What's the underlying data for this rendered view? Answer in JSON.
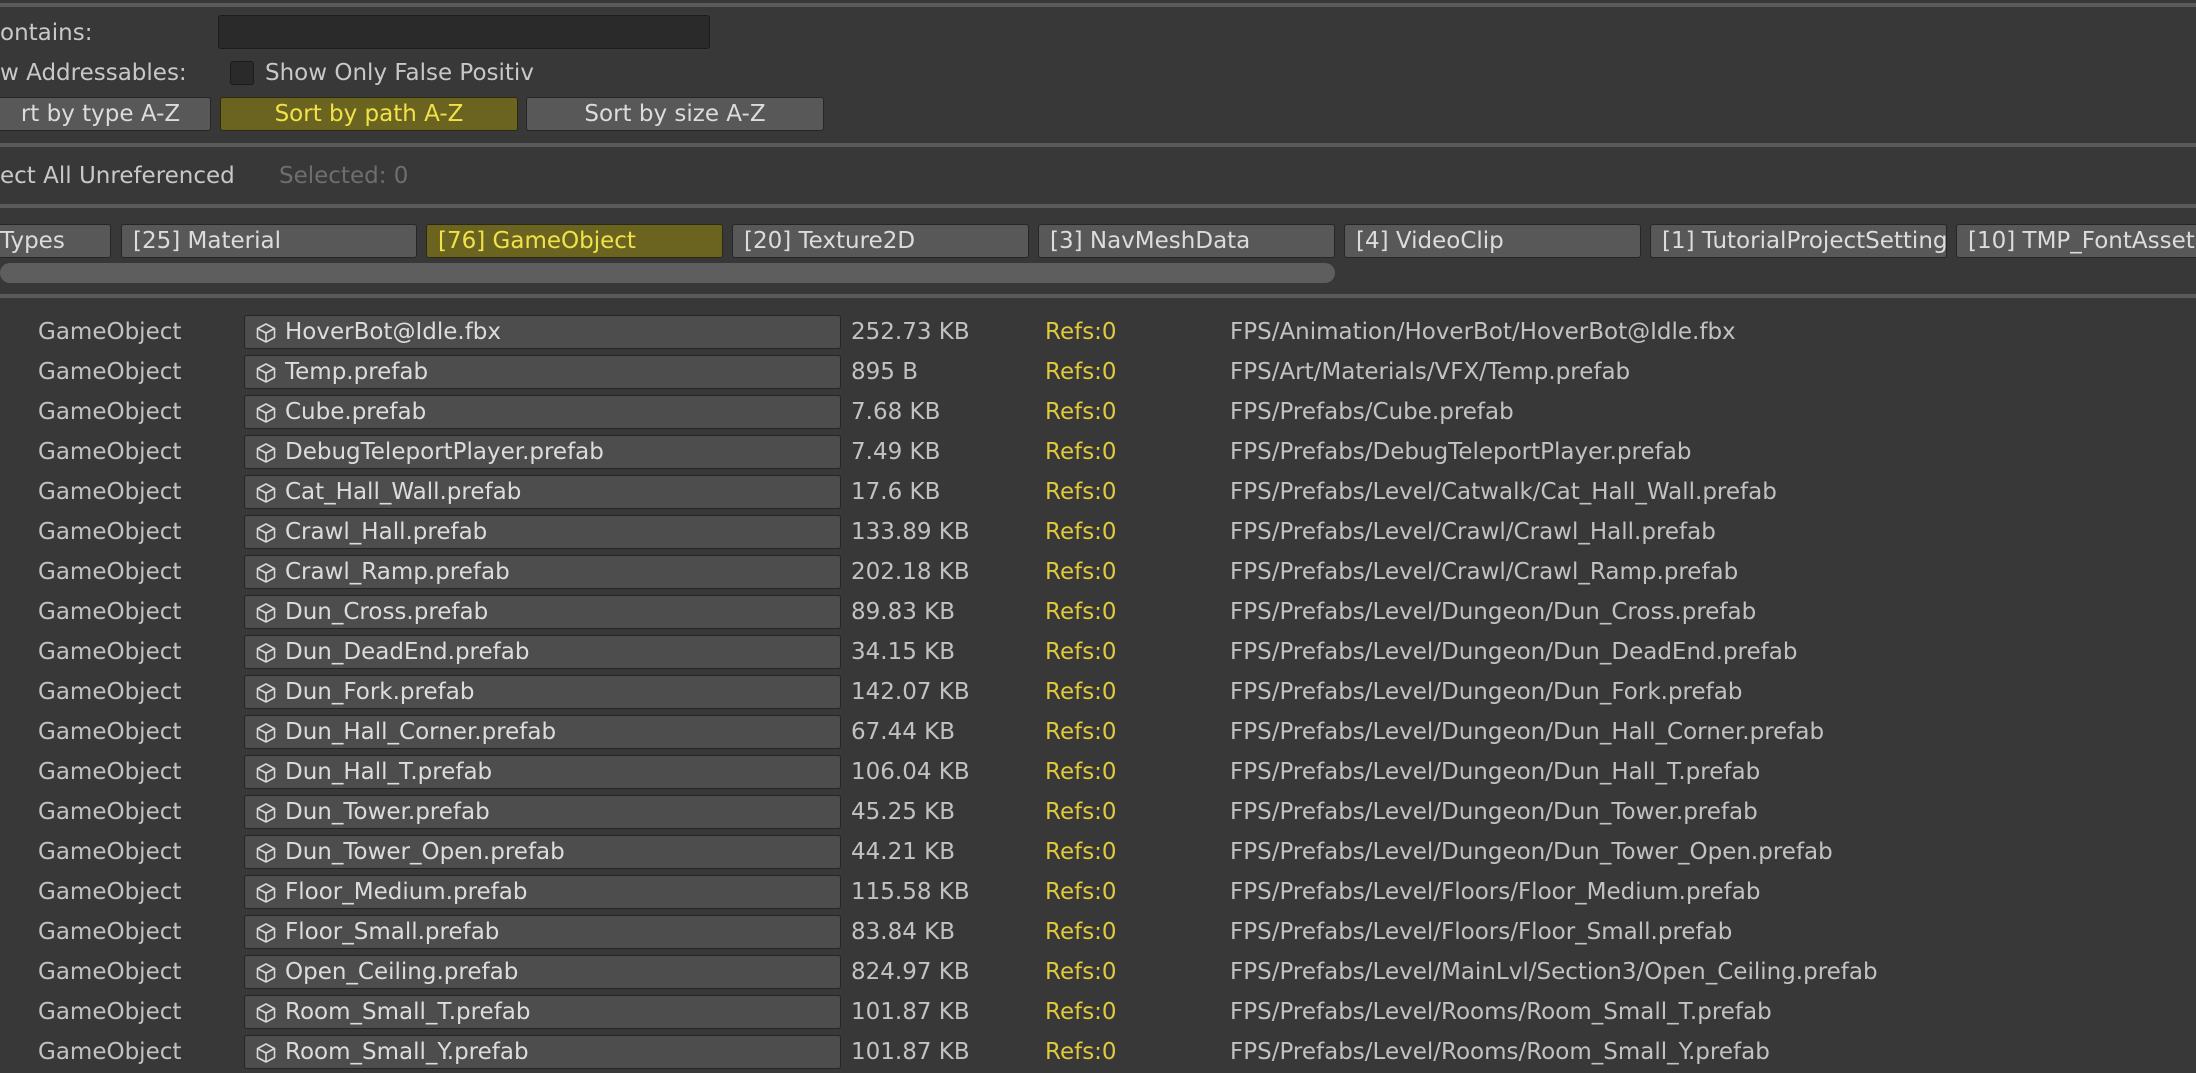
{
  "filters": {
    "contains_label": "ontains:",
    "contains_value": "",
    "show_addressables_label": "w Addressables:",
    "false_positives_label": "Show Only False Positiv",
    "false_positives_checked": false
  },
  "sort_buttons": [
    {
      "label": "rt by type A-Z",
      "active": false
    },
    {
      "label": "Sort by path A-Z",
      "active": true
    },
    {
      "label": "Sort by size A-Z",
      "active": false
    }
  ],
  "selection": {
    "select_all_label": "ect All Unreferenced",
    "selected_text": "Selected: 0"
  },
  "type_tabs": [
    {
      "label": "Types",
      "active": false
    },
    {
      "label": "[25] Material",
      "active": false
    },
    {
      "label": "[76] GameObject",
      "active": true
    },
    {
      "label": "[20] Texture2D",
      "active": false
    },
    {
      "label": "[3] NavMeshData",
      "active": false
    },
    {
      "label": "[4] VideoClip",
      "active": false
    },
    {
      "label": "[1] TutorialProjectSetting",
      "active": false
    },
    {
      "label": "[10] TMP_FontAsset",
      "active": false
    }
  ],
  "colors": {
    "background": "#383838",
    "active_button": "#6b6420",
    "active_text": "#f0e24a",
    "refs_text": "#e0c93b"
  },
  "rows": [
    {
      "type": "GameObject",
      "name": "HoverBot@Idle.fbx",
      "size": "252.73 KB",
      "refs": "Refs:0",
      "path": "FPS/Animation/HoverBot/HoverBot@Idle.fbx",
      "icon": "prefab-cube-icon"
    },
    {
      "type": "GameObject",
      "name": "Temp.prefab",
      "size": "895 B",
      "refs": "Refs:0",
      "path": "FPS/Art/Materials/VFX/Temp.prefab",
      "icon": "prefab-cube-icon"
    },
    {
      "type": "GameObject",
      "name": "Cube.prefab",
      "size": "7.68 KB",
      "refs": "Refs:0",
      "path": "FPS/Prefabs/Cube.prefab",
      "icon": "prefab-cube-icon"
    },
    {
      "type": "GameObject",
      "name": "DebugTeleportPlayer.prefab",
      "size": "7.49 KB",
      "refs": "Refs:0",
      "path": "FPS/Prefabs/DebugTeleportPlayer.prefab",
      "icon": "prefab-cube-icon"
    },
    {
      "type": "GameObject",
      "name": "Cat_Hall_Wall.prefab",
      "size": "17.6 KB",
      "refs": "Refs:0",
      "path": "FPS/Prefabs/Level/Catwalk/Cat_Hall_Wall.prefab",
      "icon": "prefab-cube-icon"
    },
    {
      "type": "GameObject",
      "name": "Crawl_Hall.prefab",
      "size": "133.89 KB",
      "refs": "Refs:0",
      "path": "FPS/Prefabs/Level/Crawl/Crawl_Hall.prefab",
      "icon": "prefab-cube-icon"
    },
    {
      "type": "GameObject",
      "name": "Crawl_Ramp.prefab",
      "size": "202.18 KB",
      "refs": "Refs:0",
      "path": "FPS/Prefabs/Level/Crawl/Crawl_Ramp.prefab",
      "icon": "prefab-cube-icon"
    },
    {
      "type": "GameObject",
      "name": "Dun_Cross.prefab",
      "size": "89.83 KB",
      "refs": "Refs:0",
      "path": "FPS/Prefabs/Level/Dungeon/Dun_Cross.prefab",
      "icon": "prefab-cube-icon"
    },
    {
      "type": "GameObject",
      "name": "Dun_DeadEnd.prefab",
      "size": "34.15 KB",
      "refs": "Refs:0",
      "path": "FPS/Prefabs/Level/Dungeon/Dun_DeadEnd.prefab",
      "icon": "prefab-cube-icon"
    },
    {
      "type": "GameObject",
      "name": "Dun_Fork.prefab",
      "size": "142.07 KB",
      "refs": "Refs:0",
      "path": "FPS/Prefabs/Level/Dungeon/Dun_Fork.prefab",
      "icon": "prefab-cube-icon"
    },
    {
      "type": "GameObject",
      "name": "Dun_Hall_Corner.prefab",
      "size": "67.44 KB",
      "refs": "Refs:0",
      "path": "FPS/Prefabs/Level/Dungeon/Dun_Hall_Corner.prefab",
      "icon": "prefab-cube-icon"
    },
    {
      "type": "GameObject",
      "name": "Dun_Hall_T.prefab",
      "size": "106.04 KB",
      "refs": "Refs:0",
      "path": "FPS/Prefabs/Level/Dungeon/Dun_Hall_T.prefab",
      "icon": "prefab-cube-icon"
    },
    {
      "type": "GameObject",
      "name": "Dun_Tower.prefab",
      "size": "45.25 KB",
      "refs": "Refs:0",
      "path": "FPS/Prefabs/Level/Dungeon/Dun_Tower.prefab",
      "icon": "prefab-cube-icon"
    },
    {
      "type": "GameObject",
      "name": "Dun_Tower_Open.prefab",
      "size": "44.21 KB",
      "refs": "Refs:0",
      "path": "FPS/Prefabs/Level/Dungeon/Dun_Tower_Open.prefab",
      "icon": "prefab-cube-icon"
    },
    {
      "type": "GameObject",
      "name": "Floor_Medium.prefab",
      "size": "115.58 KB",
      "refs": "Refs:0",
      "path": "FPS/Prefabs/Level/Floors/Floor_Medium.prefab",
      "icon": "prefab-cube-icon"
    },
    {
      "type": "GameObject",
      "name": "Floor_Small.prefab",
      "size": "83.84 KB",
      "refs": "Refs:0",
      "path": "FPS/Prefabs/Level/Floors/Floor_Small.prefab",
      "icon": "prefab-cube-icon"
    },
    {
      "type": "GameObject",
      "name": "Open_Ceiling.prefab",
      "size": "824.97 KB",
      "refs": "Refs:0",
      "path": "FPS/Prefabs/Level/MainLvl/Section3/Open_Ceiling.prefab",
      "icon": "prefab-cube-icon"
    },
    {
      "type": "GameObject",
      "name": "Room_Small_T.prefab",
      "size": "101.87 KB",
      "refs": "Refs:0",
      "path": "FPS/Prefabs/Level/Rooms/Room_Small_T.prefab",
      "icon": "prefab-cube-icon"
    },
    {
      "type": "GameObject",
      "name": "Room_Small_Y.prefab",
      "size": "101.87 KB",
      "refs": "Refs:0",
      "path": "FPS/Prefabs/Level/Rooms/Room_Small_Y.prefab",
      "icon": "prefab-cube-icon"
    }
  ]
}
